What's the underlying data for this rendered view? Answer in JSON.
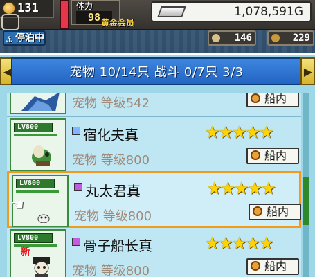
{
  "status": {
    "level": "131",
    "stamina_label": "体力",
    "stamina_value": "98",
    "vip_label": "黄金会员",
    "gold": "1,078,591G",
    "docked_label": "停泊中",
    "count_a": "146",
    "count_b": "229"
  },
  "panel": {
    "header_text": "宠物 10/14只 战斗 0/7只 3/3",
    "left_arrow": "◀",
    "right_arrow": "▶"
  },
  "pets": [
    {
      "name": "",
      "level_text": "宠物 等级542",
      "lv_badge": "",
      "stars": "",
      "location": "船内",
      "element_color": "",
      "selected": false
    },
    {
      "name": "宿化夫真",
      "level_text": "宠物 等级800",
      "lv_badge": "LV800",
      "stars": "★★★★★",
      "location": "船内",
      "element_color": "#7fb6ff",
      "selected": false
    },
    {
      "name": "丸太君真",
      "level_text": "宠物 等级800",
      "lv_badge": "LV800",
      "stars": "★★★★★",
      "location": "船内",
      "element_color": "#c35be0",
      "selected": true
    },
    {
      "name": "骨子船长真",
      "level_text": "宠物 等级800",
      "lv_badge": "LV800",
      "stars": "★★★★★",
      "location": "船内",
      "element_color": "#c35be0",
      "selected": false,
      "new_badge": "新"
    }
  ],
  "colors": {
    "panel_bg": "#9ed7e8",
    "header_blue": "#2365c2",
    "selected_border": "#f29a1a",
    "star": "#ffd400"
  }
}
